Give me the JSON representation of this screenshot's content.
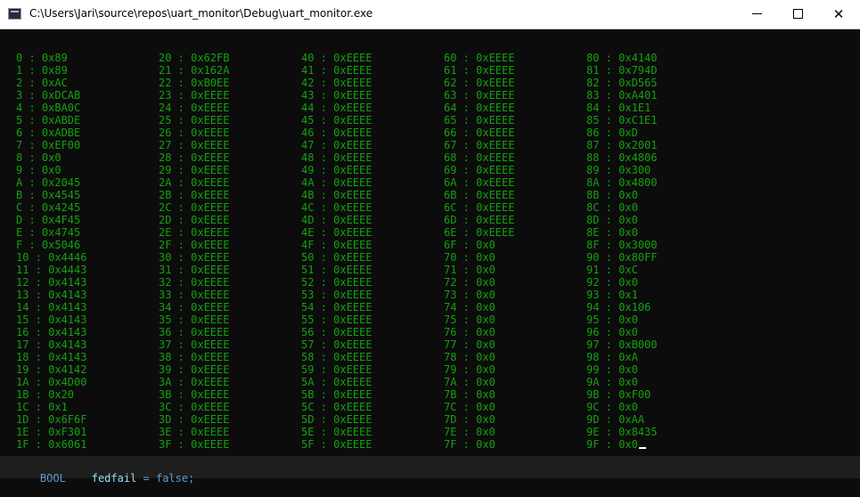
{
  "window": {
    "title": "C:\\Users\\Jari\\source\\repos\\uart_monitor\\Debug\\uart_monitor.exe",
    "minimize_glyph": "—",
    "maximize_glyph": "☐",
    "close_glyph": "✕"
  },
  "console": {
    "columns": [
      [
        "0 : 0x89",
        "1 : 0x89",
        "2 : 0xAC",
        "3 : 0xDCAB",
        "4 : 0xBA0C",
        "5 : 0xABDE",
        "6 : 0xADBE",
        "7 : 0xEF00",
        "8 : 0x0",
        "9 : 0x0",
        "A : 0x2045",
        "B : 0x4545",
        "C : 0x4245",
        "D : 0x4F45",
        "E : 0x4745",
        "F : 0x5046",
        "10 : 0x4446",
        "11 : 0x4443",
        "12 : 0x4143",
        "13 : 0x4143",
        "14 : 0x4143",
        "15 : 0x4143",
        "16 : 0x4143",
        "17 : 0x4143",
        "18 : 0x4143",
        "19 : 0x4142",
        "1A : 0x4D00",
        "1B : 0x20",
        "1C : 0x1",
        "1D : 0x6F6F",
        "1E : 0xF301",
        "1F : 0x6061"
      ],
      [
        "20 : 0x62FB",
        "21 : 0x162A",
        "22 : 0xB0EE",
        "23 : 0xEEEE",
        "24 : 0xEEEE",
        "25 : 0xEEEE",
        "26 : 0xEEEE",
        "27 : 0xEEEE",
        "28 : 0xEEEE",
        "29 : 0xEEEE",
        "2A : 0xEEEE",
        "2B : 0xEEEE",
        "2C : 0xEEEE",
        "2D : 0xEEEE",
        "2E : 0xEEEE",
        "2F : 0xEEEE",
        "30 : 0xEEEE",
        "31 : 0xEEEE",
        "32 : 0xEEEE",
        "33 : 0xEEEE",
        "34 : 0xEEEE",
        "35 : 0xEEEE",
        "36 : 0xEEEE",
        "37 : 0xEEEE",
        "38 : 0xEEEE",
        "39 : 0xEEEE",
        "3A : 0xEEEE",
        "3B : 0xEEEE",
        "3C : 0xEEEE",
        "3D : 0xEEEE",
        "3E : 0xEEEE",
        "3F : 0xEEEE"
      ],
      [
        "40 : 0xEEEE",
        "41 : 0xEEEE",
        "42 : 0xEEEE",
        "43 : 0xEEEE",
        "44 : 0xEEEE",
        "45 : 0xEEEE",
        "46 : 0xEEEE",
        "47 : 0xEEEE",
        "48 : 0xEEEE",
        "49 : 0xEEEE",
        "4A : 0xEEEE",
        "4B : 0xEEEE",
        "4C : 0xEEEE",
        "4D : 0xEEEE",
        "4E : 0xEEEE",
        "4F : 0xEEEE",
        "50 : 0xEEEE",
        "51 : 0xEEEE",
        "52 : 0xEEEE",
        "53 : 0xEEEE",
        "54 : 0xEEEE",
        "55 : 0xEEEE",
        "56 : 0xEEEE",
        "57 : 0xEEEE",
        "58 : 0xEEEE",
        "59 : 0xEEEE",
        "5A : 0xEEEE",
        "5B : 0xEEEE",
        "5C : 0xEEEE",
        "5D : 0xEEEE",
        "5E : 0xEEEE",
        "5F : 0xEEEE"
      ],
      [
        "60 : 0xEEEE",
        "61 : 0xEEEE",
        "62 : 0xEEEE",
        "63 : 0xEEEE",
        "64 : 0xEEEE",
        "65 : 0xEEEE",
        "66 : 0xEEEE",
        "67 : 0xEEEE",
        "68 : 0xEEEE",
        "69 : 0xEEEE",
        "6A : 0xEEEE",
        "6B : 0xEEEE",
        "6C : 0xEEEE",
        "6D : 0xEEEE",
        "6E : 0xEEEE",
        "6F : 0x0",
        "70 : 0x0",
        "71 : 0x0",
        "72 : 0x0",
        "73 : 0x0",
        "74 : 0x0",
        "75 : 0x0",
        "76 : 0x0",
        "77 : 0x0",
        "78 : 0x0",
        "79 : 0x0",
        "7A : 0x0",
        "7B : 0x0",
        "7C : 0x0",
        "7D : 0x0",
        "7E : 0x0",
        "7F : 0x0"
      ],
      [
        "80 : 0x4140",
        "81 : 0x794D",
        "82 : 0xD565",
        "83 : 0xA401",
        "84 : 0x1E1",
        "85 : 0xC1E1",
        "86 : 0xD",
        "87 : 0x2001",
        "88 : 0x4806",
        "89 : 0x300",
        "8A : 0x4800",
        "8B : 0x0",
        "8C : 0x0",
        "8D : 0x0",
        "8E : 0x0",
        "8F : 0x3000",
        "90 : 0x80FF",
        "91 : 0xC",
        "92 : 0x0",
        "93 : 0x1",
        "94 : 0x106",
        "95 : 0x0",
        "96 : 0x0",
        "97 : 0xB000",
        "98 : 0xA",
        "99 : 0x0",
        "9A : 0x0",
        "9B : 0xF00",
        "9C : 0x0",
        "9D : 0xAA",
        "9E : 0x8435",
        "9F : 0x0"
      ]
    ]
  },
  "background_code": {
    "type_keyword": "BOOL",
    "variable": "fedfail",
    "rest": "= false;"
  },
  "colors": {
    "console_text": "#13a10e",
    "console_bg": "#0c0c0c"
  },
  "icons": {
    "app": "console-app-icon"
  }
}
